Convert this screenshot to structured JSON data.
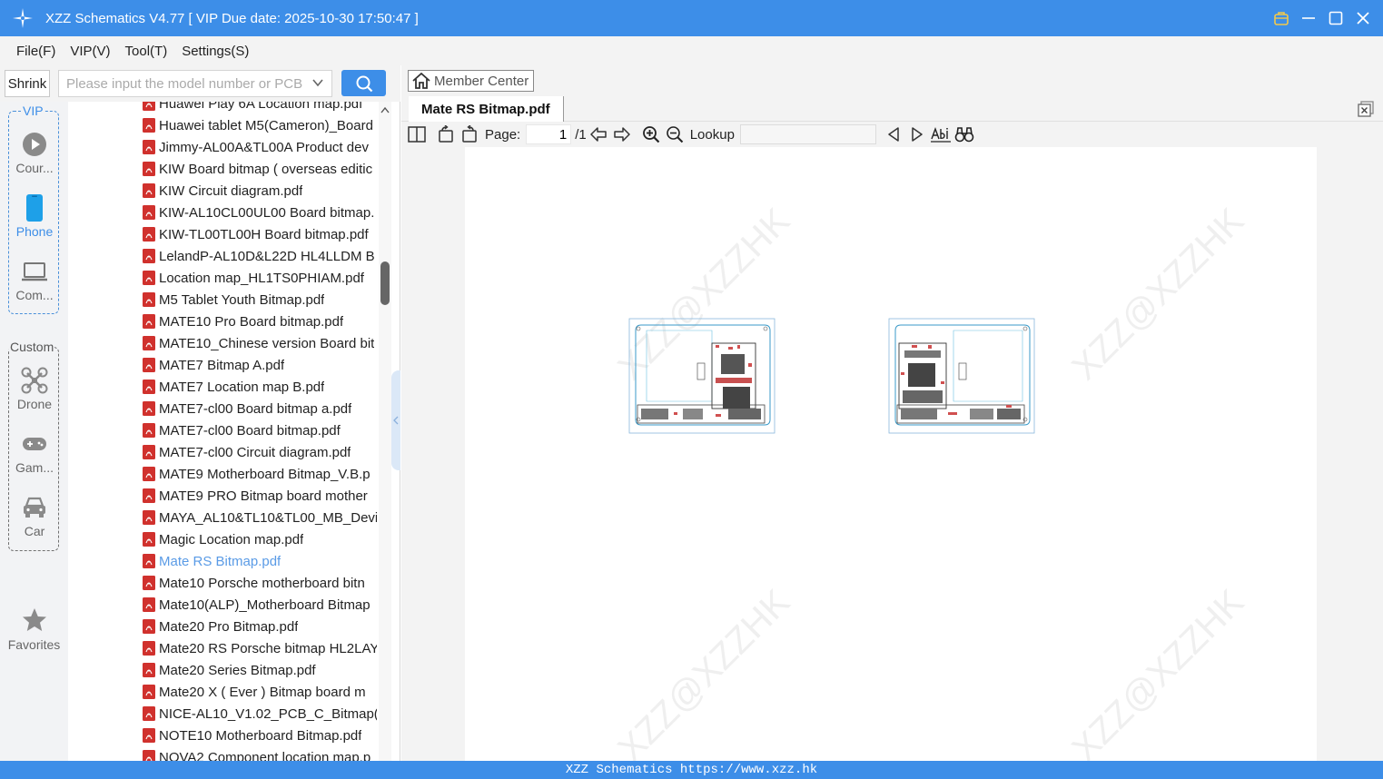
{
  "window": {
    "title": "XZZ Schematics V4.77 [ VIP Due date: 2025-10-30 17:50:47 ]"
  },
  "menu": [
    "File(F)",
    "VIP(V)",
    "Tool(T)",
    "Settings(S)"
  ],
  "search": {
    "shrink_label": "Shrink",
    "placeholder": "Please input the model number or PCB",
    "value": ""
  },
  "categories": {
    "vip_group_label": "VIP",
    "vip_items": [
      {
        "label": "Cour...",
        "icon": "play-icon"
      },
      {
        "label": "Phone",
        "icon": "phone-icon",
        "active": true
      },
      {
        "label": "Com...",
        "icon": "laptop-icon"
      }
    ],
    "custom_group_label": "Custom",
    "custom_items": [
      {
        "label": "Drone",
        "icon": "drone-icon"
      },
      {
        "label": "Gam...",
        "icon": "gamepad-icon"
      },
      {
        "label": "Car",
        "icon": "car-icon"
      }
    ],
    "favorites_label": "Favorites"
  },
  "files": [
    "Huawei Play 6A Location map.pdf",
    "Huawei tablet M5(Cameron)_Board",
    "Jimmy-AL00A&TL00A Product dev",
    "KIW Board bitmap ( overseas editic",
    "KIW Circuit diagram.pdf",
    "KIW-AL10CL00UL00 Board bitmap.",
    "KIW-TL00TL00H Board bitmap.pdf",
    "LelandP-AL10D&L22D HL4LLDM B",
    "Location map_HL1TS0PHIAM.pdf",
    "M5 Tablet Youth Bitmap.pdf",
    "MATE10 Pro Board bitmap.pdf",
    "MATE10_Chinese version Board bit",
    "MATE7 Bitmap A.pdf",
    "MATE7 Location map B.pdf",
    "MATE7-cl00 Board bitmap a.pdf",
    "MATE7-cl00 Board bitmap.pdf",
    "MATE7-cl00 Circuit diagram.pdf",
    "MATE9 Motherboard Bitmap_V.B.p",
    "MATE9 PRO Bitmap board mother",
    "MAYA_AL10&TL10&TL00_MB_Devi",
    "Magic Location map.pdf",
    "Mate RS Bitmap.pdf",
    "Mate10 Porsche motherboard bitn",
    "Mate10(ALP)_Motherboard Bitmap",
    "Mate20 Pro Bitmap.pdf",
    "Mate20 RS Porsche bitmap HL2LAY",
    "Mate20 Series Bitmap.pdf",
    "Mate20 X ( Ever ) Bitmap board m",
    "NICE-AL10_V1.02_PCB_C_Bitmap(1(",
    "NOTE10 Motherboard Bitmap.pdf",
    "NOVA2 Component location map.p"
  ],
  "selected_file_index": 21,
  "viewer": {
    "member_center_label": "Member Center",
    "tab_label": "Mate RS Bitmap.pdf",
    "page_label": "Page:",
    "page_current": "1",
    "page_total": "/1",
    "lookup_label": "Lookup",
    "lookup_value": "",
    "watermark_text": "XZZ@XZZHK"
  },
  "status": "XZZ Schematics https://www.xzz.hk",
  "colors": {
    "accent": "#3d8ee8",
    "selected_text": "#5a9be6",
    "pdf_icon": "#d0312d"
  }
}
